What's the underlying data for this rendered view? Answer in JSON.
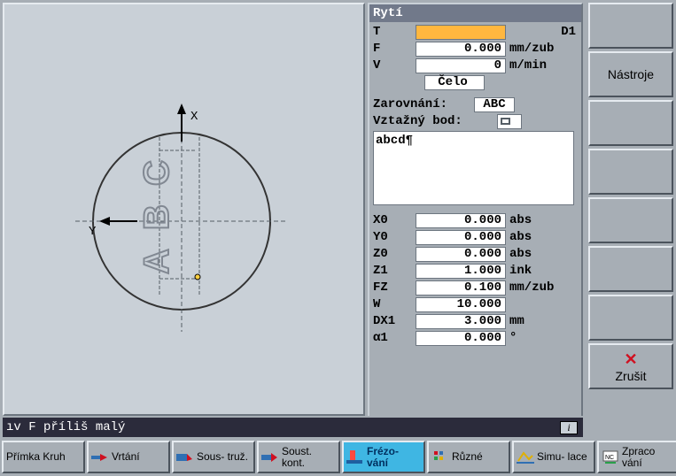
{
  "panel": {
    "title": "Rytí",
    "T_label": "T",
    "T_value": "",
    "T_corner": "D1",
    "F_label": "F",
    "F_value": "0.000",
    "F_unit": "mm/zub",
    "V_label": "V",
    "V_value": "0",
    "V_unit": "m/min",
    "celo": "Čelo",
    "align_label": "Zarovnání:",
    "align_value": "ABC",
    "ref_label": "Vztažný bod:",
    "text_value": "abcd¶",
    "X0_label": "X0",
    "X0_value": "0.000",
    "X0_unit": "abs",
    "Y0_label": "Y0",
    "Y0_value": "0.000",
    "Y0_unit": "abs",
    "Z0_label": "Z0",
    "Z0_value": "0.000",
    "Z0_unit": "abs",
    "Z1_label": "Z1",
    "Z1_value": "1.000",
    "Z1_unit": "ink",
    "FZ_label": "FZ",
    "FZ_value": "0.100",
    "FZ_unit": "mm/zub",
    "W_label": "W",
    "W_value": "10.000",
    "W_unit": "",
    "DX1_label": "DX1",
    "DX1_value": "3.000",
    "DX1_unit": "mm",
    "a1_label": "α1",
    "a1_value": "0.000",
    "a1_unit": "°"
  },
  "rightbar": {
    "tools": "Nástroje",
    "cancel": "Zrušit"
  },
  "status": {
    "msg": "ıv F příliš malý"
  },
  "bottombar": {
    "b1": "Přímka Kruh",
    "b2": "Vrtání",
    "b3": "Sous- truž.",
    "b4": "Soust. kont.",
    "b5": "Frézo- vání",
    "b6": "Různé",
    "b7": "Simu- lace",
    "b8": "Zpraco vání"
  }
}
